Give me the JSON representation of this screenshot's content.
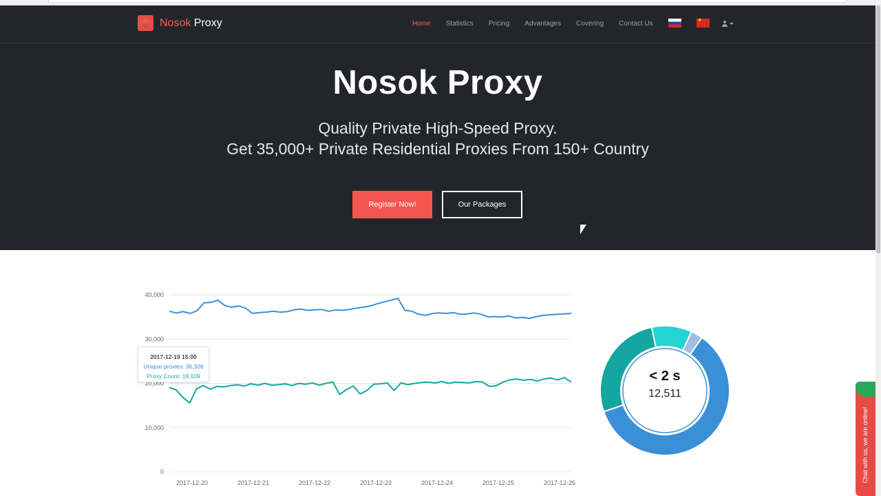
{
  "brand": {
    "name_part1": "Nosok",
    "name_part2": " Proxy"
  },
  "nav": {
    "items": [
      {
        "label": "Home",
        "active": true
      },
      {
        "label": "Statistics"
      },
      {
        "label": "Pricing"
      },
      {
        "label": "Advantages"
      },
      {
        "label": "Covering"
      },
      {
        "label": "Contact Us"
      }
    ],
    "flags": [
      "flag-ru-icon",
      "flag-cn-icon"
    ],
    "user_icon": "user-icon"
  },
  "hero": {
    "title": "Nosok Proxy",
    "subtitle_line1": "Quality Private High-Speed Proxy.",
    "subtitle_line2": "Get 35,000+ Private Residential Proxies From 150+ Country",
    "register_label": "Register Now!",
    "packages_label": "Our Packages"
  },
  "tooltip": {
    "date": "2017-12-19 15:00",
    "unique": "Unique proxies: 36,308",
    "count": "Proxy Count: 19,109"
  },
  "chart_data": [
    {
      "type": "line",
      "x": [
        "2017-12-20",
        "2017-12-21",
        "2017-12-22",
        "2017-12-23",
        "2017-12-24",
        "2017-12-25",
        "2017-12-26"
      ],
      "yticks": [
        "0",
        "10,000",
        "20,000",
        "30,000",
        "40,000"
      ],
      "ylim": [
        0,
        40000
      ],
      "grid": true,
      "series": [
        {
          "color": "#3b8fd6",
          "values": [
            36300,
            35900,
            36200,
            35800,
            36400,
            38200,
            38300,
            38800,
            37600,
            37200,
            37500,
            37000,
            35800,
            36000,
            36100,
            36300,
            36100,
            36200,
            36600,
            36800,
            36500,
            36600,
            36700,
            36300,
            36600,
            36500,
            36700,
            37000,
            37200,
            37500,
            38000,
            38400,
            38800,
            39200,
            36500,
            36300,
            35600,
            35400,
            35800,
            35900,
            35800,
            36000,
            35600,
            35700,
            35900,
            35600,
            35000,
            35100,
            35000,
            35200,
            34800,
            34900,
            34700,
            35100,
            35400,
            35500,
            35600,
            35700,
            35800
          ]
        },
        {
          "color": "#14a6a0",
          "values": [
            19100,
            18500,
            16800,
            15600,
            18800,
            19500,
            18700,
            19300,
            19200,
            19500,
            19700,
            19400,
            19900,
            19600,
            20000,
            19600,
            19700,
            19900,
            19500,
            20000,
            19800,
            20100,
            19600,
            20000,
            20300,
            17500,
            18600,
            19400,
            17600,
            18400,
            19800,
            19900,
            20100,
            18400,
            20100,
            19700,
            20000,
            20200,
            20300,
            20100,
            20400,
            20000,
            20300,
            20200,
            20100,
            20400,
            20300,
            19300,
            19500,
            20300,
            20800,
            21000,
            20700,
            20900,
            20500,
            21000,
            21200,
            20800,
            21300,
            20300
          ]
        }
      ]
    },
    {
      "type": "pie",
      "center_label": "< 2 s",
      "center_value": "12,511",
      "slices": [
        {
          "value": 60,
          "color": "#3b8fd6"
        },
        {
          "value": 27,
          "color": "#14a6a0"
        },
        {
          "value": 10,
          "color": "#23d4d2"
        },
        {
          "value": 3,
          "color": "#9ebfe0"
        }
      ]
    }
  ],
  "chat": {
    "label": "Chat with us, we are online!"
  }
}
